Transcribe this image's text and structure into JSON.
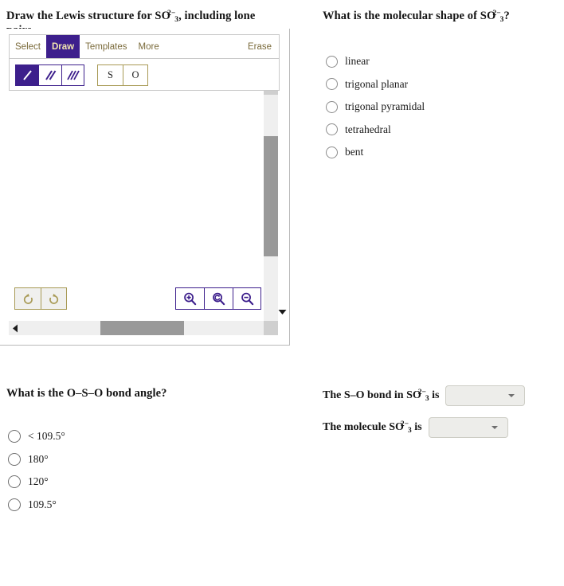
{
  "lewis": {
    "prompt_pre": "Draw the Lewis structure for ",
    "formula": "SO",
    "formula_sub": "3",
    "formula_sup": "2−",
    "prompt_post": ", including lone pairs.",
    "toolbar": {
      "tabs": [
        {
          "label": "Select",
          "active": false
        },
        {
          "label": "Draw",
          "active": true
        },
        {
          "label": "Templates",
          "active": false
        },
        {
          "label": "More",
          "active": false
        }
      ],
      "erase_label": "Erase",
      "bond_tools": [
        {
          "name": "single-bond",
          "selected": true
        },
        {
          "name": "double-bond",
          "selected": false
        },
        {
          "name": "triple-bond",
          "selected": false
        }
      ],
      "atom_tools": [
        {
          "label": "S"
        },
        {
          "label": "O"
        }
      ],
      "history": [
        {
          "name": "undo",
          "glyph": "↺"
        },
        {
          "name": "redo",
          "glyph": "↻"
        }
      ],
      "zoom_tools": [
        {
          "name": "zoom-in"
        },
        {
          "name": "zoom-reset"
        },
        {
          "name": "zoom-out"
        }
      ]
    },
    "colors": {
      "accent_purple": "#3d1f8c",
      "accent_gold": "#a89a55",
      "tab_text": "#7a6a3a",
      "scroll_thumb": "#999999",
      "scroll_track": "#efefef"
    }
  },
  "shape": {
    "prompt_pre": "What is the molecular shape of ",
    "formula": "SO",
    "formula_sub": "3",
    "formula_sup": "2−",
    "prompt_post": "?",
    "options": [
      {
        "label": "linear",
        "selected": false
      },
      {
        "label": "trigonal planar",
        "selected": false
      },
      {
        "label": "trigonal pyramidal",
        "selected": false
      },
      {
        "label": "tetrahedral",
        "selected": false
      },
      {
        "label": "bent",
        "selected": false
      }
    ]
  },
  "angle": {
    "prompt": "What is the O–S–O bond angle?",
    "options": [
      {
        "label": "< 109.5°",
        "selected": false
      },
      {
        "label": "180°",
        "selected": false
      },
      {
        "label": "120°",
        "selected": false
      },
      {
        "label": "109.5°",
        "selected": false
      }
    ]
  },
  "statements": [
    {
      "name": "bond-polarity",
      "text_pre": "The S–O bond in ",
      "formula": "SO",
      "formula_sub": "3",
      "formula_sup": "2−",
      "text_post": " is",
      "dropdown_value": "",
      "dropdown_placeholder": ""
    },
    {
      "name": "molecule-polarity",
      "text_pre": "The molecule ",
      "formula": "SO",
      "formula_sub": "3",
      "formula_sup": "2−",
      "text_post": " is",
      "dropdown_value": "",
      "dropdown_placeholder": ""
    }
  ]
}
